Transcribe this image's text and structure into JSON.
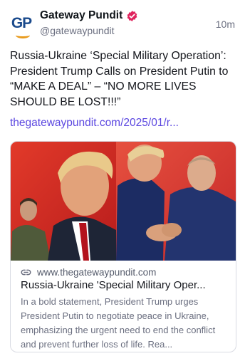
{
  "post": {
    "display_name": "Gateway Pundit",
    "handle": "@gatewaypundit",
    "time": "10m",
    "avatar_text": "GP",
    "text": "Russia-Ukraine ‘Special Military Operation’: President Trump Calls on President Putin to “MAKE A DEAL” – “NO MORE LIVES SHOULD BE LOST!!!”",
    "link_text": "thegatewaypundit.com/2025/01/r..."
  },
  "card": {
    "domain": "www.thegatewaypundit.com",
    "title": "Russia-Ukraine 'Special Military Oper...",
    "description": "In a bold statement, President Trump urges President Putin to negotiate peace in Ukraine, emphasizing the urgent need to end the conflict and prevent further loss of life. Rea..."
  },
  "icons": {
    "verified": "verified-badge-icon",
    "link": "link-icon"
  },
  "colors": {
    "link": "#5b47e0",
    "verified": "#e0245e",
    "muted": "#6b6f80",
    "avatar_blue": "#1a4a8c",
    "avatar_orange": "#e89a1c"
  }
}
